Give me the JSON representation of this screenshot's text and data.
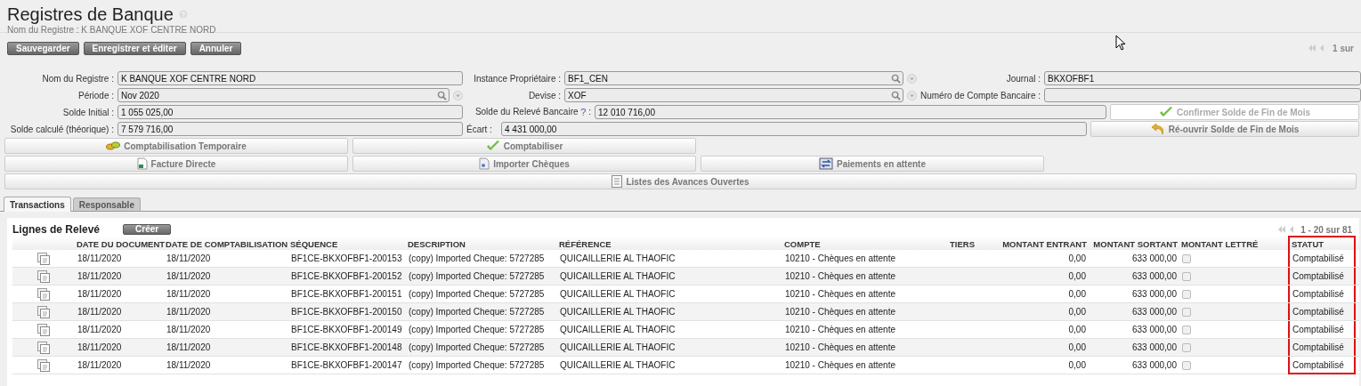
{
  "header": {
    "title": "Registres de Banque",
    "subtitle": "Nom du Registre : K BANQUE XOF CENTRE NORD"
  },
  "toolbar": {
    "buttons": [
      "Sauvegarder",
      "Enregistrer et éditer",
      "Annuler"
    ],
    "pager": "1 sur"
  },
  "form": {
    "rows": [
      [
        {
          "kind": "field",
          "label": "Nom du Registre :",
          "value": "K BANQUE XOF CENTRE NORD",
          "lookup": false
        },
        {
          "kind": "field",
          "label": "Instance Propriétaire :",
          "value": "BF1_CEN",
          "lookup": true
        },
        {
          "kind": "field",
          "label": "Journal :",
          "value": "BKXOFBF1",
          "lookup": false
        }
      ],
      [
        {
          "kind": "field",
          "label": "Période :",
          "value": "Nov 2020",
          "lookup": true
        },
        {
          "kind": "field",
          "label": "Devise :",
          "value": "XOF",
          "lookup": true
        },
        {
          "kind": "field",
          "label": "Numéro de Compte Bancaire :",
          "lookup": false
        }
      ],
      [
        {
          "kind": "field",
          "label": "Solde Initial :",
          "value": "1 055 025,00",
          "lookup": false
        },
        {
          "kind": "field",
          "label": "Solde du Relevé Bancaire",
          "help": "?",
          "colon": ":",
          "value": "12 010 716,00",
          "lookup": false
        },
        {
          "kind": "button",
          "label": "Confirmer Solde de Fin de Mois",
          "disabled": true
        }
      ],
      [
        {
          "kind": "field",
          "label": "Solde calculé (théorique) :",
          "value": "7 579 716,00",
          "lookup": false
        },
        {
          "kind": "field",
          "label": "Écart :",
          "value": "4 431 000,00",
          "lookup": false
        },
        {
          "kind": "button",
          "label": "Ré-ouvrir Solde de Fin de Mois",
          "disabled": false
        }
      ]
    ]
  },
  "actions": [
    [
      "Comptabilisation Temporaire",
      "Comptabiliser"
    ],
    [
      "Facture Directe",
      "Importer Chèques",
      "Paiements en attente"
    ],
    [
      "Listes des Avances Ouvertes"
    ]
  ],
  "tabs": [
    {
      "label": "Transactions",
      "selected": true
    },
    {
      "label": "Responsable",
      "selected": false
    }
  ],
  "panel": {
    "title": "Lignes de Relevé",
    "create_button": "Créer",
    "pager": "1 - 20 sur 81"
  },
  "table": {
    "columns": [
      {
        "label": "DATE DU DOCUMENT",
        "highlighted": false
      },
      {
        "label": "DATE DE COMPTABILISATION",
        "highlighted": false
      },
      {
        "label": "SÉQUENCE",
        "highlighted": false
      },
      {
        "label": "DESCRIPTION",
        "highlighted": false
      },
      {
        "label": "RÉFÉRENCE",
        "highlighted": false
      },
      {
        "label": "COMPTE",
        "highlighted": false
      },
      {
        "label": "TIERS",
        "highlighted": false
      },
      {
        "label": "MONTANT ENTRANT",
        "highlighted": false
      },
      {
        "label": "MONTANT SORTANT",
        "highlighted": false
      },
      {
        "label": "MONTANT LETTRÉ",
        "highlighted": false
      },
      {
        "label": "STATUT",
        "highlighted": true
      }
    ],
    "rows": [
      {
        "doc_date": "18/11/2020",
        "posting_date": "18/11/2020",
        "sequence": "BF1CE-BKXOFBF1-200153",
        "description": "(copy) Imported Cheque: 5727285",
        "reference": "QUICAILLERIE AL THAOFIC",
        "account": "10210 - Chèques en attente",
        "amount_in": "0,00",
        "amount_out": "633 000,00",
        "matched": false,
        "status": "Comptabilisé"
      },
      {
        "doc_date": "18/11/2020",
        "posting_date": "18/11/2020",
        "sequence": "BF1CE-BKXOFBF1-200152",
        "description": "(copy) Imported Cheque: 5727285",
        "reference": "QUICAILLERIE AL THAOFIC",
        "account": "10210 - Chèques en attente",
        "amount_in": "0,00",
        "amount_out": "633 000,00",
        "matched": false,
        "status": "Comptabilisé"
      },
      {
        "doc_date": "18/11/2020",
        "posting_date": "18/11/2020",
        "sequence": "BF1CE-BKXOFBF1-200151",
        "description": "(copy) Imported Cheque: 5727285",
        "reference": "QUICAILLERIE AL THAOFIC",
        "account": "10210 - Chèques en attente",
        "amount_in": "0,00",
        "amount_out": "633 000,00",
        "matched": false,
        "status": "Comptabilisé"
      },
      {
        "doc_date": "18/11/2020",
        "posting_date": "18/11/2020",
        "sequence": "BF1CE-BKXOFBF1-200150",
        "description": "(copy) Imported Cheque: 5727285",
        "reference": "QUICAILLERIE AL THAOFIC",
        "account": "10210 - Chèques en attente",
        "amount_in": "0,00",
        "amount_out": "633 000,00",
        "matched": false,
        "status": "Comptabilisé"
      },
      {
        "doc_date": "18/11/2020",
        "posting_date": "18/11/2020",
        "sequence": "BF1CE-BKXOFBF1-200149",
        "description": "(copy) Imported Cheque: 5727285",
        "reference": "QUICAILLERIE AL THAOFIC",
        "account": "10210 - Chèques en attente",
        "amount_in": "0,00",
        "amount_out": "633 000,00",
        "matched": false,
        "status": "Comptabilisé"
      },
      {
        "doc_date": "18/11/2020",
        "posting_date": "18/11/2020",
        "sequence": "BF1CE-BKXOFBF1-200148",
        "description": "(copy) Imported Cheque: 5727285",
        "reference": "QUICAILLERIE AL THAOFIC",
        "account": "10210 - Chèques en attente",
        "amount_in": "0,00",
        "amount_out": "633 000,00",
        "matched": false,
        "status": "Comptabilisé"
      },
      {
        "doc_date": "18/11/2020",
        "posting_date": "18/11/2020",
        "sequence": "BF1CE-BKXOFBF1-200147",
        "description": "(copy) Imported Cheque: 5727285",
        "reference": "QUICAILLERIE AL THAOFIC",
        "account": "10210 - Chèques en attente",
        "amount_in": "0,00",
        "amount_out": "633 000,00",
        "matched": false,
        "status": "Comptabilisé"
      }
    ]
  }
}
